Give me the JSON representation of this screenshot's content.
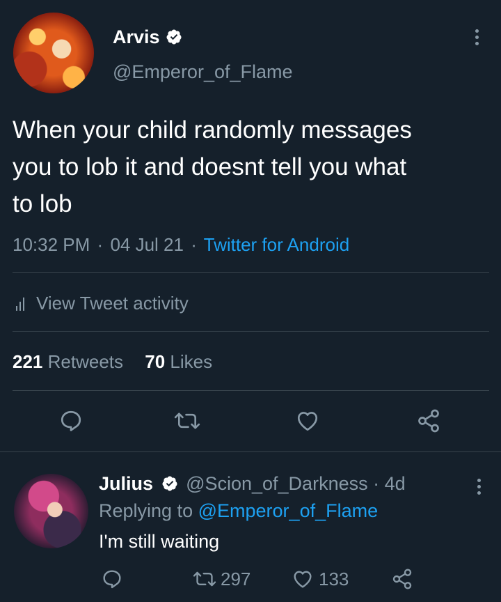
{
  "tweet": {
    "author_name": "Arvis",
    "author_handle": "@Emperor_of_Flame",
    "text_lines": [
      "When your child randomly messages",
      "you to lob it and doesnt tell you what",
      "to lob"
    ],
    "time": "10:32 PM",
    "separator": "·",
    "date": "04 Jul 21",
    "source": "Twitter for Android",
    "activity_label": "View Tweet activity",
    "retweets_count": "221",
    "retweets_label": "Retweets",
    "likes_count": "70",
    "likes_label": "Likes"
  },
  "reply": {
    "author_name": "Julius",
    "author_handle": "@Scion_of_Darkness",
    "separator": "·",
    "age": "4d",
    "replying_prefix": "Replying to",
    "replying_handle": "@Emperor_of_Flame",
    "text": "I'm still waiting",
    "retweets_count": "297",
    "likes_count": "133"
  },
  "icons": {
    "verified": "verified-badge-icon",
    "more": "more-vertical-icon",
    "reply": "reply-icon",
    "retweet": "retweet-icon",
    "like": "heart-icon",
    "share": "share-icon",
    "activity": "bar-chart-icon"
  },
  "colors": {
    "background": "#15202b",
    "accent": "#1da1f2",
    "muted": "#8899a6",
    "divider": "#38444d",
    "text": "#ffffff"
  }
}
